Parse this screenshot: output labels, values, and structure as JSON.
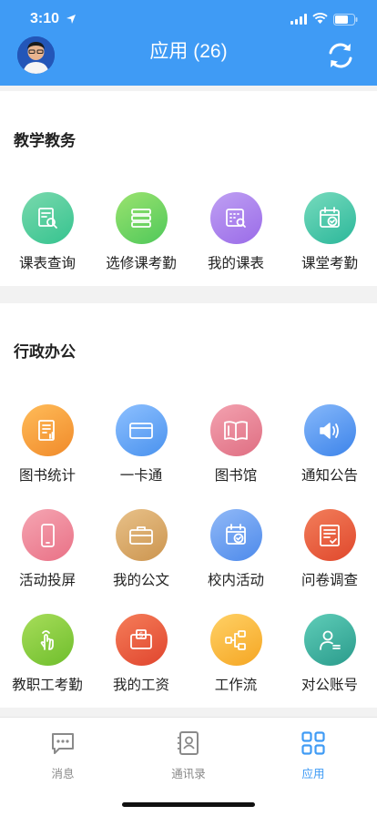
{
  "status": {
    "time": "3:10"
  },
  "header": {
    "title": "应用 (26)"
  },
  "sections": [
    {
      "title": "教学教务",
      "apps": [
        {
          "label": "课表查询",
          "icon": "schedule-search-icon",
          "color": "#35c38f",
          "color2": "#7ad9ad"
        },
        {
          "label": "选修课考勤",
          "icon": "elective-attendance-icon",
          "color": "#4fc85a",
          "color2": "#9be36f"
        },
        {
          "label": "我的课表",
          "icon": "calendar-search-icon",
          "color": "#9a6be8",
          "color2": "#bfa0f3"
        },
        {
          "label": "课堂考勤",
          "icon": "calendar-check-icon",
          "color": "#2bb79a",
          "color2": "#77dbbd"
        }
      ]
    },
    {
      "title": "行政办公",
      "apps": [
        {
          "label": "图书统计",
          "icon": "book-stats-icon",
          "color": "#f08a2a",
          "color2": "#ffbc59"
        },
        {
          "label": "一卡通",
          "icon": "card-icon",
          "color": "#4a92ee",
          "color2": "#8dc0ff"
        },
        {
          "label": "图书馆",
          "icon": "library-book-icon",
          "color": "#df6e82",
          "color2": "#f3a2b0"
        },
        {
          "label": "通知公告",
          "icon": "speaker-icon",
          "color": "#3d84ea",
          "color2": "#86b8fa"
        },
        {
          "label": "活动投屏",
          "icon": "phone-icon",
          "color": "#e97186",
          "color2": "#f5a5b2"
        },
        {
          "label": "我的公文",
          "icon": "briefcase-icon",
          "color": "#cc954f",
          "color2": "#e8c189"
        },
        {
          "label": "校内活动",
          "icon": "calendar-check-icon",
          "color": "#4d8aeb",
          "color2": "#91b9f7"
        },
        {
          "label": "问卷调查",
          "icon": "survey-icon",
          "color": "#e0482c",
          "color2": "#f27e5b"
        },
        {
          "label": "教职工考勤",
          "icon": "touch-hand-icon",
          "color": "#6fbe2c",
          "color2": "#a7dd5a"
        },
        {
          "label": "我的工资",
          "icon": "wallet-icon",
          "color": "#e0452e",
          "color2": "#f57d59"
        },
        {
          "label": "工作流",
          "icon": "workflow-icon",
          "color": "#f5a623",
          "color2": "#ffd166"
        },
        {
          "label": "对公账号",
          "icon": "account-user-icon",
          "color": "#2a9b8c",
          "color2": "#5fcdb8"
        }
      ]
    }
  ],
  "tabbar": {
    "items": [
      {
        "label": "消息",
        "icon": "message-icon",
        "active": false
      },
      {
        "label": "通讯录",
        "icon": "contacts-icon",
        "active": false
      },
      {
        "label": "应用",
        "icon": "apps-grid-icon",
        "active": true
      }
    ]
  },
  "colors": {
    "header": "#3f9bf5",
    "active": "#3f9bf5",
    "inactive": "#8a8a8a"
  }
}
